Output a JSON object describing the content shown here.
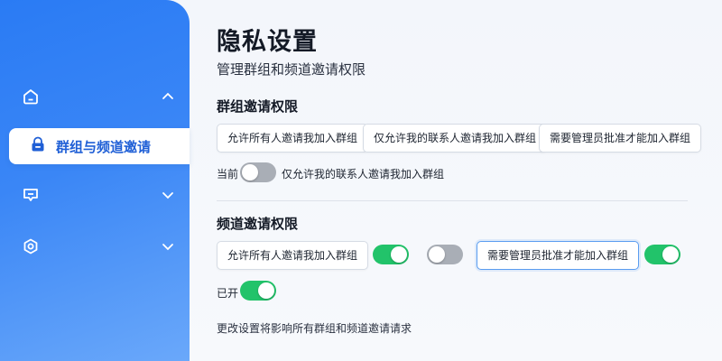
{
  "sidebar": {
    "items": [
      {
        "icon": "home-icon",
        "state": "expanded"
      },
      {
        "icon": "lock-icon",
        "label": "群组与频道邀请",
        "active": true
      },
      {
        "icon": "message-icon",
        "state": "collapsed"
      },
      {
        "icon": "settings-icon",
        "state": "collapsed"
      }
    ]
  },
  "header": {
    "title": "隐私设置",
    "subtitle": "管理群组和频道邀请权限"
  },
  "group_section": {
    "title": "群组邀请权限",
    "options": [
      "允许所有人邀请我加入群组",
      "仅允许我的联系人邀请我加入群组",
      "需要管理员批准才能加入群组"
    ],
    "current_label": "当前",
    "current_value": "仅允许我的联系人邀请我加入群组",
    "toggle_on": false
  },
  "channel_section": {
    "title": "频道邀请权限",
    "options": [
      "允许所有人邀请我加入群组",
      "需要管理员批准才能加入群组"
    ],
    "toggles": [
      true,
      false,
      true
    ],
    "status_label": "已开",
    "status_toggle_on": true
  },
  "footnote": "更改设置将影响所有群组和频道邀请请求",
  "colors": {
    "sidebar_accent": "#2a7bf4",
    "toggle_on": "#22c36a",
    "toggle_off": "#a9aeb6",
    "active_text": "#1f5fd6"
  }
}
